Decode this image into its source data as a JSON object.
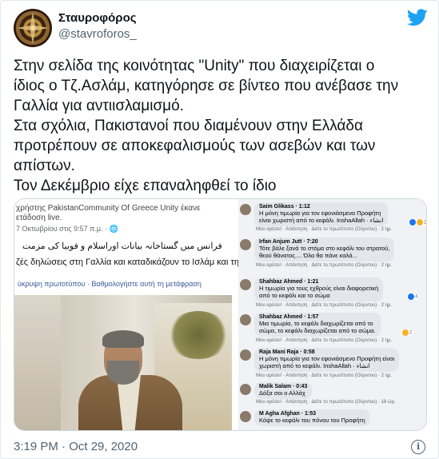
{
  "tweet": {
    "display_name": "Σταυροφόρος",
    "handle": "@stavroforos_",
    "icons": {
      "brand": "twitter-bird-icon",
      "info": "info-icon"
    },
    "colors": {
      "brand": "#1da1f2",
      "text": "#0f1419",
      "muted": "#536471"
    },
    "text_lines": [
      "Στην σελίδα της κοινότητας \"Unity\" που διαχειρίζεται ο",
      "ίδιος ο Τζ.Ασλάμ, κατηγόρησε σε βίντεο που ανέβασε την",
      "Γαλλία για αντιισλαμισμό.",
      "Στα σχόλια, Πακιστανοί που διαμένουν στην Ελλάδα",
      "προτρέπουν σε αποκεφαλισμούς των ασεβών και των",
      "απίστων.",
      "Τον Δεκέμβριο είχε επαναληφθεί το ίδιο"
    ],
    "timestamp": "3:19 PM · Oct 29, 2020"
  },
  "media": {
    "post": {
      "line1": "χρήστης PakistanCommunity Of Greece Unity έκανε",
      "line2": "ετάδοση live.",
      "meta": "7 Οκτωβρίου στις 9:57 π.μ. · 🌐",
      "urdu": "فرانس میں گستاخانہ بیانات اوراسلام و فوبیا کی مزمت",
      "greek": "ζές δηλώσεις στη Γαλλία και καταδικάζουν το Ισλάμ και τη",
      "translate": "ύκρυψη πρωτοτύπου · Βαθμολογήστε αυτή τη μετάφραση"
    },
    "comments": [
      {
        "name": "Saim Glikass · 1:12",
        "text": [
          "Η μόνη τιμωρία για τον εφονιάσμενο Προφήτη",
          "είναι χωριστή από το κεφάλι. InshaAllah · انشاء"
        ],
        "actions": "Μου αρέσει! · Απάντηση · Δείτε το πρωτότυπο (Ούρντου) · 2 ημ.",
        "react": "13"
      },
      {
        "name": "Irfan Anjum Jutt · 7:20",
        "text": [
          "Τότε βάλε ξανά το στόμα στο κεφάλι του στρατού,",
          "θεού θάνατος.... Όλα θα πάνε καλά..."
        ],
        "actions": "Μου αρέσει! · Απάντηση · Δείτε το πρωτότυπο (Ούρντου) · 2 ημ.",
        "react": ""
      },
      {
        "name": "Shahbaz Ahmed · 1:21",
        "text": [
          "Η τιμωρία για τους εχθρούς είναι διαφορετική",
          "από το κεφάλι και το σώμα"
        ],
        "actions": "Μου αρέσει! · Απάντηση · Δείτε το πρωτότυπο (Ούρντου) · 2 ημ.",
        "react": "4"
      },
      {
        "name": "Shahbaz Ahmed · 1:57",
        "text": [
          "Μια τιμωρία, το κεφάλι διαχωρίζεται από το",
          "σώμα, το κεφάλι διαχωρίζεται από το σώμα."
        ],
        "actions": "Μου αρέσει! · Απάντηση · Δείτε το πρωτότυπο (Ούρντου) · 2 ημ.",
        "react": "2"
      },
      {
        "name": "Raja Mani Raja · 0:58",
        "text": [
          "Η μόνη τιμωρία για τον εφονιάσμενο Προφήτη είναι",
          "χωριστή από το κεφάλι. InshaAllah · انشاء"
        ],
        "actions": "Μου αρέσει! · Απάντηση · Δείτε το πρωτότυπο (Ούρντου) · 2 ημ.",
        "react": ""
      },
      {
        "name": "Malik Salam · 0:43",
        "text": [
          "Δόξα σοι ο Αλλάχ"
        ],
        "actions": "Μου αρέσει! · Απάντηση · Δείτε το πρωτότυπο (Ούρντου) · 18 ώρ.",
        "react": ""
      },
      {
        "name": "M Agha Afghan · 1:53",
        "text": [
          "Κόψε το κεφάλι του πόνου του Προφήτη"
        ],
        "actions": "Μου αρέσει! · Απάντηση · Δείτε το πρωτότυπο (Ούρντου) · 2 ημ.",
        "react": ""
      }
    ]
  }
}
